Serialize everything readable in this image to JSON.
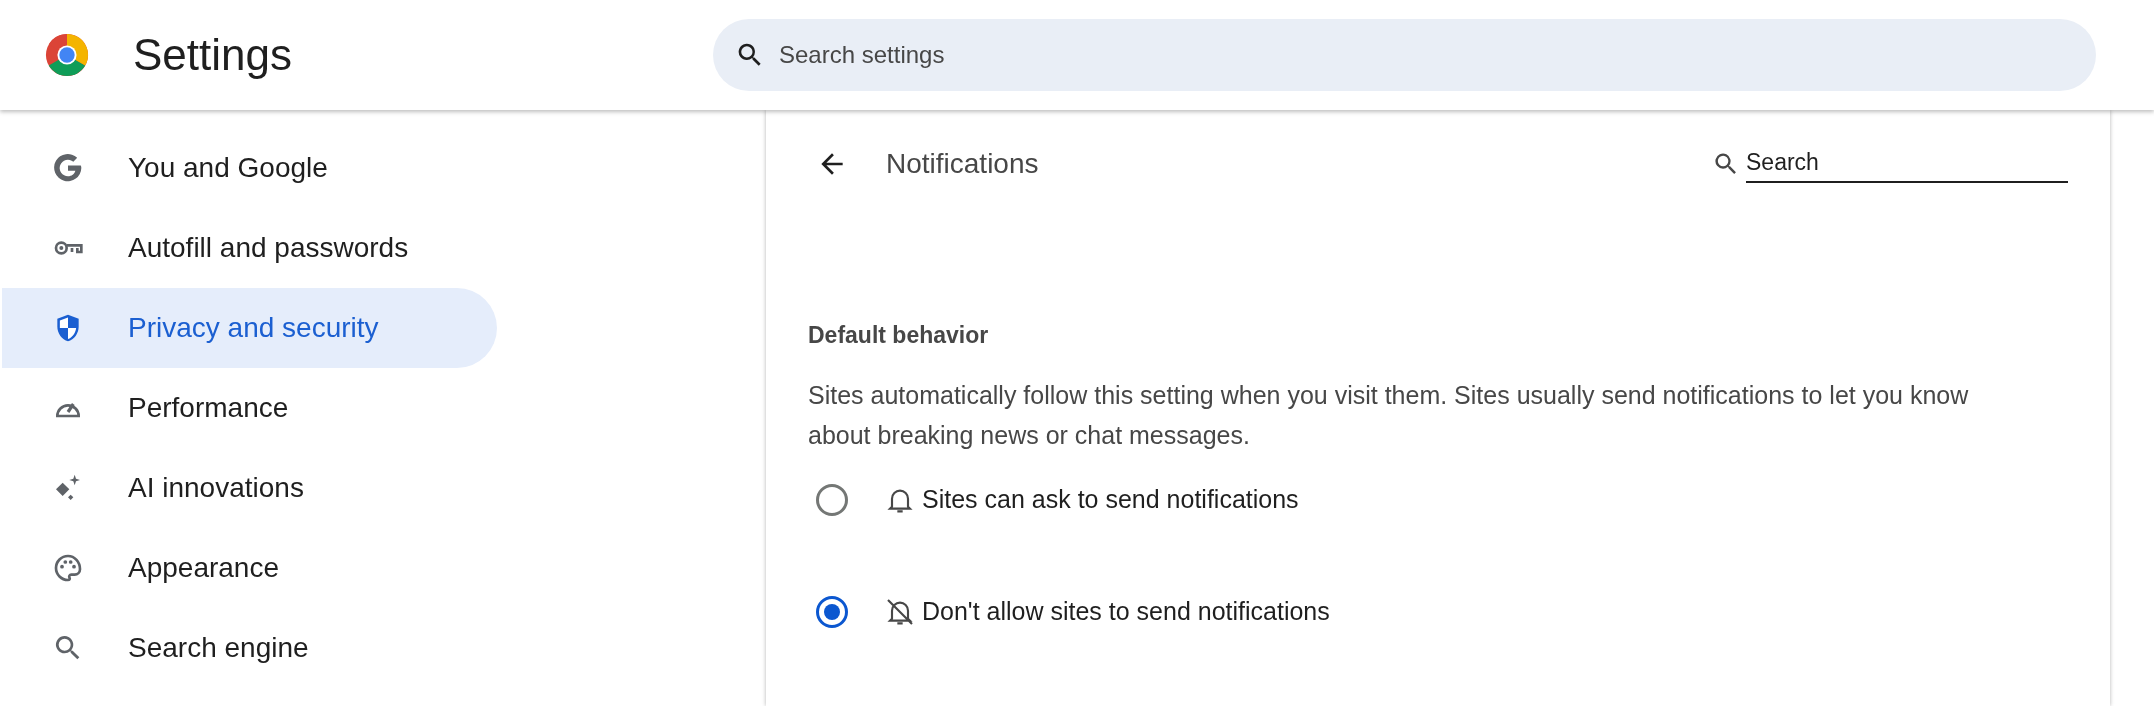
{
  "header": {
    "title": "Settings",
    "search": {
      "placeholder": "Search settings"
    }
  },
  "sidebar": {
    "items": [
      {
        "label": "You and Google",
        "kind": "google",
        "selected": false
      },
      {
        "label": "Autofill and passwords",
        "kind": "key",
        "selected": false
      },
      {
        "label": "Privacy and security",
        "kind": "shield",
        "selected": true
      },
      {
        "label": "Performance",
        "kind": "gauge",
        "selected": false
      },
      {
        "label": "AI innovations",
        "kind": "sparkle",
        "selected": false
      },
      {
        "label": "Appearance",
        "kind": "palette",
        "selected": false
      },
      {
        "label": "Search engine",
        "kind": "search",
        "selected": false
      }
    ]
  },
  "page": {
    "title": "Notifications",
    "search": {
      "placeholder": "Search"
    },
    "section_title": "Default behavior",
    "description": "Sites automatically follow this setting when you visit them. Sites usually send notifications to let you know about breaking news or chat messages.",
    "options": [
      {
        "label": "Sites can ask to send notifications",
        "kind": "bell",
        "selected": false
      },
      {
        "label": "Don't allow sites to send notifications",
        "kind": "bell-off",
        "selected": true
      }
    ]
  }
}
